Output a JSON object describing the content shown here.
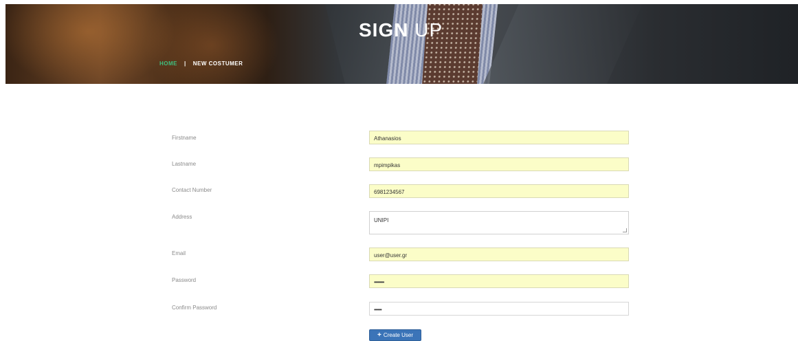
{
  "header": {
    "title_bold": "SIGN",
    "title_light": " UP",
    "breadcrumb": {
      "home": "HOME",
      "separator": "|",
      "current": "NEW COSTUMER"
    }
  },
  "form": {
    "firstname": {
      "label": "Firstname",
      "value": "Athanasios"
    },
    "lastname": {
      "label": "Lastname",
      "value": "mpimpikas"
    },
    "contact": {
      "label": "Contact Number",
      "value": "6981234567"
    },
    "address": {
      "label": "Address",
      "value": "UNIPI"
    },
    "email": {
      "label": "Email",
      "value": "user@user.gr"
    },
    "password": {
      "label": "Password",
      "value": "••••••••"
    },
    "confirm": {
      "label": "Confirm Password",
      "value": "••••••"
    },
    "submit": {
      "label": "Create User",
      "icon": "plus-icon"
    }
  },
  "colors": {
    "autofill_bg": "#fbfdc8",
    "button_bg": "#3b74b8",
    "breadcrumb_home": "#3fbf7f"
  }
}
